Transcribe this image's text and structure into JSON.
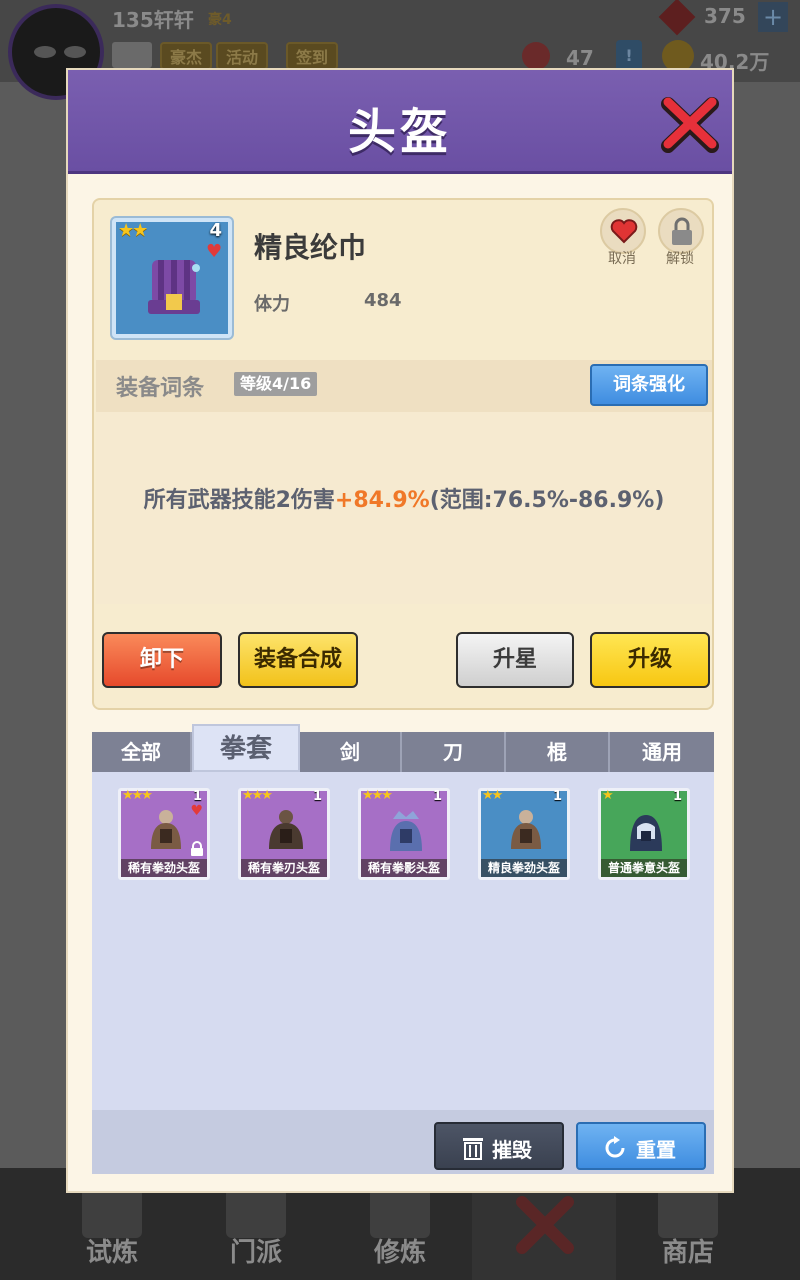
{
  "background": {
    "player_name": "135轩轩",
    "vip_label": "豪4",
    "menu_pills": [
      "豪杰",
      "活动",
      "签到"
    ],
    "gems": "375",
    "plus_symbol": "+",
    "badge_count": "47",
    "exclaim_symbol": "!",
    "gold": "40.2万",
    "nav": [
      {
        "label": "试炼",
        "icon": "ninja-icon"
      },
      {
        "label": "门派",
        "icon": "temple-icon"
      },
      {
        "label": "修炼",
        "icon": "book-icon"
      },
      {
        "label": "",
        "icon": "crossed-swords-icon"
      },
      {
        "label": "商店",
        "icon": "shop-icon"
      }
    ]
  },
  "dialog": {
    "title": "头盔",
    "item": {
      "name": "精良纶巾",
      "stars": "★★",
      "level": "4",
      "stat_label": "体力",
      "stat_value": "484",
      "favorite_label": "取消",
      "unlock_label": "解锁"
    },
    "affix": {
      "title": "装备词条",
      "level": "等级4/16",
      "enhance_button": "词条强化",
      "text_prefix": "所有武器技能2伤害",
      "text_value": "+84.9%",
      "text_range": "(范围:76.5%-86.9%)"
    },
    "actions": {
      "unequip": "卸下",
      "synthesize": "装备合成",
      "star_up": "升星",
      "upgrade": "升级"
    },
    "tabs": [
      "全部",
      "拳套",
      "剑",
      "刀",
      "棍",
      "通用"
    ],
    "active_tab": "拳套",
    "inventory": [
      {
        "name": "稀有拳劲头盔",
        "stars": "★★★",
        "level": "1",
        "rarity": "purple",
        "favorite": true,
        "locked": true
      },
      {
        "name": "稀有拳刃头盔",
        "stars": "★★★",
        "level": "1",
        "rarity": "purple",
        "favorite": false,
        "locked": false
      },
      {
        "name": "稀有拳影头盔",
        "stars": "★★★",
        "level": "1",
        "rarity": "purple",
        "favorite": false,
        "locked": false
      },
      {
        "name": "精良拳劲头盔",
        "stars": "★★",
        "level": "1",
        "rarity": "blue",
        "favorite": false,
        "locked": false
      },
      {
        "name": "普通拳意头盔",
        "stars": "★",
        "level": "1",
        "rarity": "green",
        "favorite": false,
        "locked": false
      }
    ],
    "footer": {
      "destroy": "摧毁",
      "reset": "重置"
    }
  },
  "colors": {
    "header_purple": "#6a4fa3",
    "rarity_purple": "#a66fc6",
    "rarity_blue": "#4a8ec5",
    "rarity_green": "#47a65a",
    "highlight_orange": "#f07828"
  }
}
